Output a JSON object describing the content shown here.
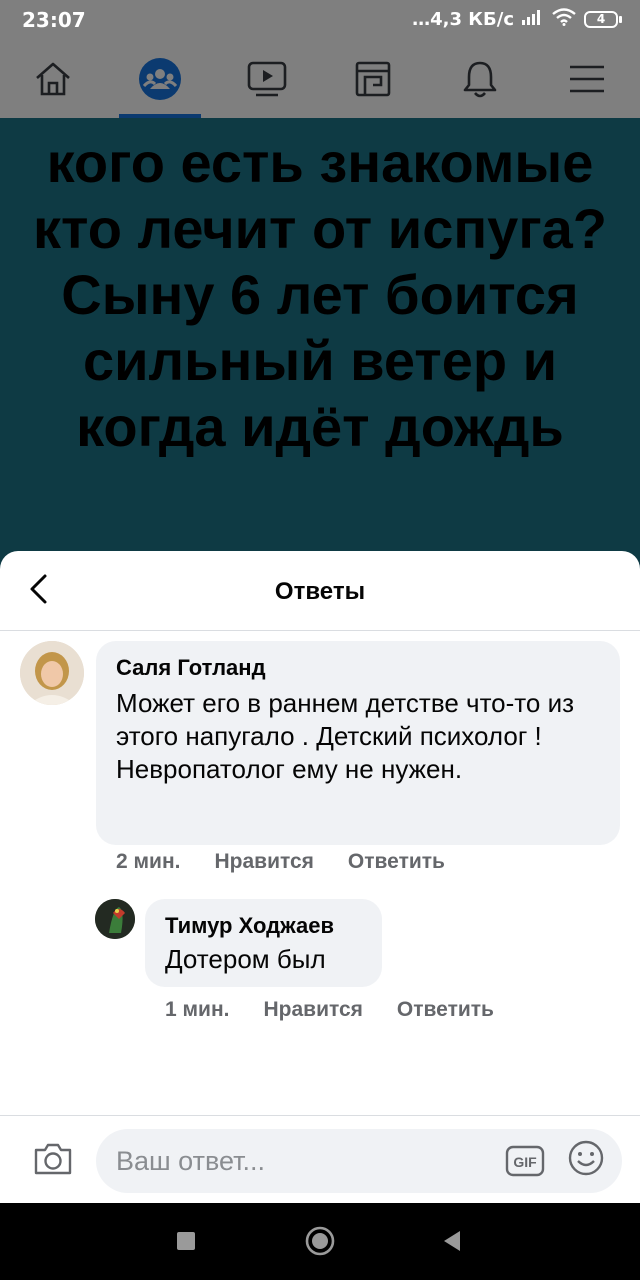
{
  "status_bar": {
    "time": "23:07",
    "network_speed": "…4,3 КБ/с",
    "battery_level": "4"
  },
  "top_nav": {
    "tabs": [
      "home-icon",
      "groups-icon",
      "watch-icon",
      "pages-icon",
      "notifications-icon",
      "menu-icon"
    ],
    "active_tab": "groups-icon",
    "active_color": "#0b3a70"
  },
  "post_image": {
    "text": "кого есть знакомые кто лечит от испуга? Сыну 6 лет боится сильный ветер и когда идёт дождь",
    "background_color": "#0e3a44"
  },
  "replies_sheet": {
    "title": "Ответы",
    "comments": [
      {
        "author": "Саля Готланд",
        "text": "Может его в раннем детстве что-то из этого напугало . Детский психолог ! Невропатолог ему не нужен.",
        "time": "2 мин.",
        "like_label": "Нравится",
        "reply_label": "Ответить"
      },
      {
        "author": "Тимур Ходжаев",
        "text": "Дотером был",
        "time": "1 мин.",
        "like_label": "Нравится",
        "reply_label": "Ответить"
      }
    ]
  },
  "composer": {
    "placeholder": "Ваш ответ...",
    "gif_label": "GIF"
  },
  "system_nav": {
    "buttons": [
      "recents-icon",
      "home-circle-icon",
      "back-triangle-icon"
    ]
  }
}
